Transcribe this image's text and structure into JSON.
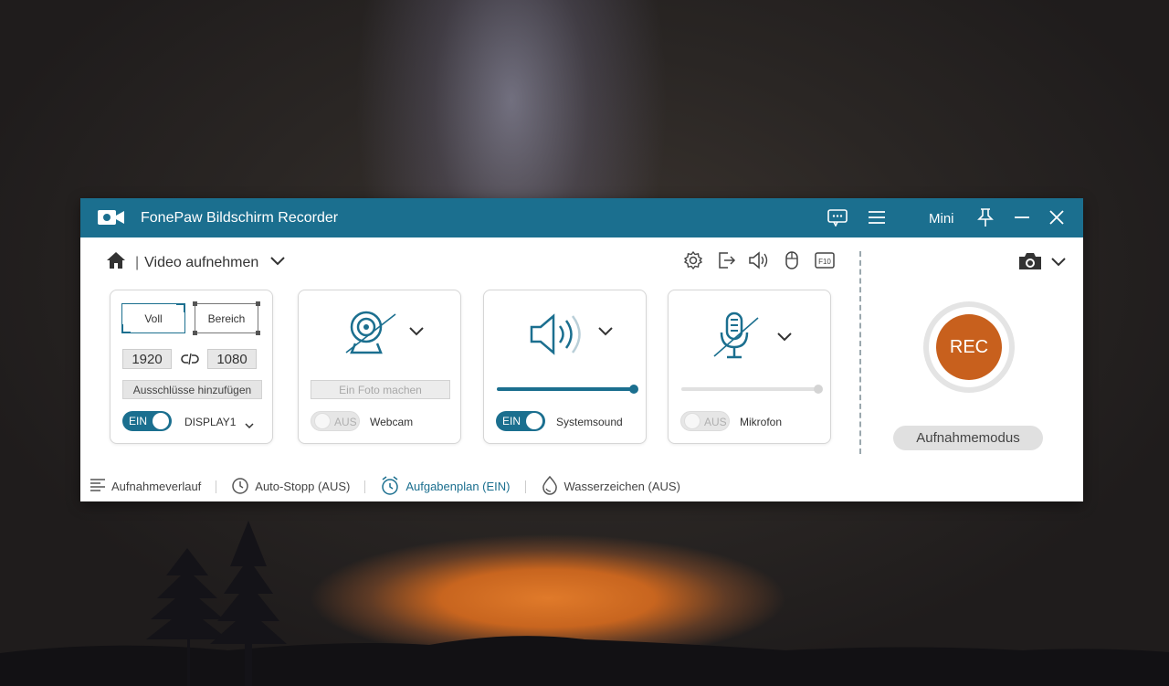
{
  "titlebar": {
    "title": "FonePaw Bildschirm Recorder",
    "mini_label": "Mini",
    "icons": [
      "app-logo-icon",
      "feedback-icon",
      "menu-icon",
      "pin-icon",
      "minimize-icon",
      "close-icon"
    ]
  },
  "header": {
    "mode_label": "Video aufnehmen",
    "separator": "|",
    "tools": [
      "settings-icon",
      "export-icon",
      "speaker-icon",
      "mouse-icon",
      "hotkey-icon"
    ],
    "hotkey_text": "F10"
  },
  "display_card": {
    "full_label": "Voll",
    "area_label": "Bereich",
    "width": "1920",
    "height": "1080",
    "exclude_label": "Ausschlüsse hinzufügen",
    "toggle_label": "EIN",
    "display_select": "DISPLAY1"
  },
  "webcam_card": {
    "photo_label": "Ein Foto machen",
    "toggle_label": "AUS",
    "label": "Webcam"
  },
  "systemsound_card": {
    "toggle_label": "EIN",
    "label": "Systemsound",
    "volume": 1.0
  },
  "mic_card": {
    "toggle_label": "AUS",
    "label": "Mikrofon",
    "volume": 1.0
  },
  "right_panel": {
    "rec_label": "REC",
    "mode_button": "Aufnahmemodus"
  },
  "bottom_bar": {
    "history": "Aufnahmeverlauf",
    "auto_stop": "Auto-Stopp (AUS)",
    "schedule": "Aufgabenplan (EIN)",
    "watermark": "Wasserzeichen (AUS)"
  },
  "colors": {
    "accent": "#1b6f8f",
    "rec": "#c8601d",
    "titlebar": "#1b6f8f"
  }
}
